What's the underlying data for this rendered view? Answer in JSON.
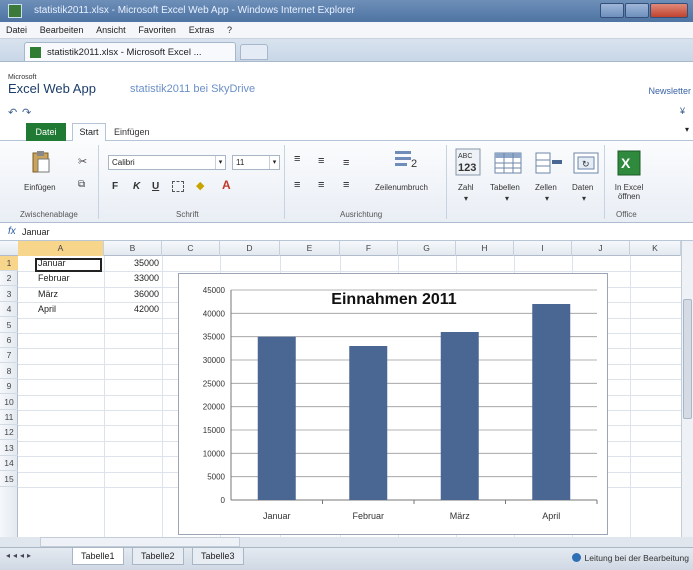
{
  "window": {
    "title": "statistik2011.xlsx - Microsoft Excel Web App - Windows Internet Explorer"
  },
  "menu": [
    "Datei",
    "Bearbeiten",
    "Ansicht",
    "Favoriten",
    "Extras",
    "?"
  ],
  "browser_tab": {
    "label": "statistik2011.xlsx - Microsoft Excel ..."
  },
  "app": {
    "microsoft": "Microsoft",
    "brand": "Excel Web App",
    "file_link": "statistik2011 bei SkyDrive",
    "right_link": "Newsletter"
  },
  "ribbon_tabs": {
    "datei": "Datei",
    "start": "Start",
    "einfuegen": "Einfügen"
  },
  "ribbon": {
    "paste": "Einfügen",
    "font_name": "Calibri",
    "font_size": "11",
    "bold": "F",
    "italic": "K",
    "underline": "U",
    "wrap_text": "Zeilenumbruch",
    "number": "Zahl",
    "tables": "Tabellen",
    "cells": "Zellen",
    "data": "Daten",
    "open_excel": "In Excel öffnen",
    "groups": {
      "clipboard": "Zwischenablage",
      "font": "Schrift",
      "alignment": "Ausrichtung",
      "office": "Office"
    }
  },
  "formula_bar": {
    "fx": "fx",
    "value": "Januar"
  },
  "columns": [
    "A",
    "B",
    "C",
    "D",
    "E",
    "F",
    "G",
    "H",
    "I",
    "J",
    "K"
  ],
  "rows": [
    "1",
    "2",
    "3",
    "4",
    "5",
    "6",
    "7",
    "8",
    "9",
    "10",
    "11",
    "12",
    "13",
    "14",
    "15"
  ],
  "cells": [
    {
      "a": "Januar",
      "b": "35000"
    },
    {
      "a": "Februar",
      "b": "33000"
    },
    {
      "a": "März",
      "b": "36000"
    },
    {
      "a": "April",
      "b": "42000"
    }
  ],
  "chart_data": {
    "type": "bar",
    "title": "Einnahmen 2011",
    "categories": [
      "Januar",
      "Februar",
      "März",
      "April"
    ],
    "values": [
      35000,
      33000,
      36000,
      42000
    ],
    "yticks": [
      "0",
      "5000",
      "10000",
      "15000",
      "20000",
      "25000",
      "30000",
      "35000",
      "40000",
      "45000"
    ],
    "ylim": [
      0,
      45000
    ],
    "bar_color": "#4a6794",
    "grid": true,
    "xlabel": "",
    "ylabel": ""
  },
  "sheets": [
    "Tabelle1",
    "Tabelle2",
    "Tabelle3"
  ],
  "status": {
    "text": "Leitung bei der Bearbeitung"
  }
}
